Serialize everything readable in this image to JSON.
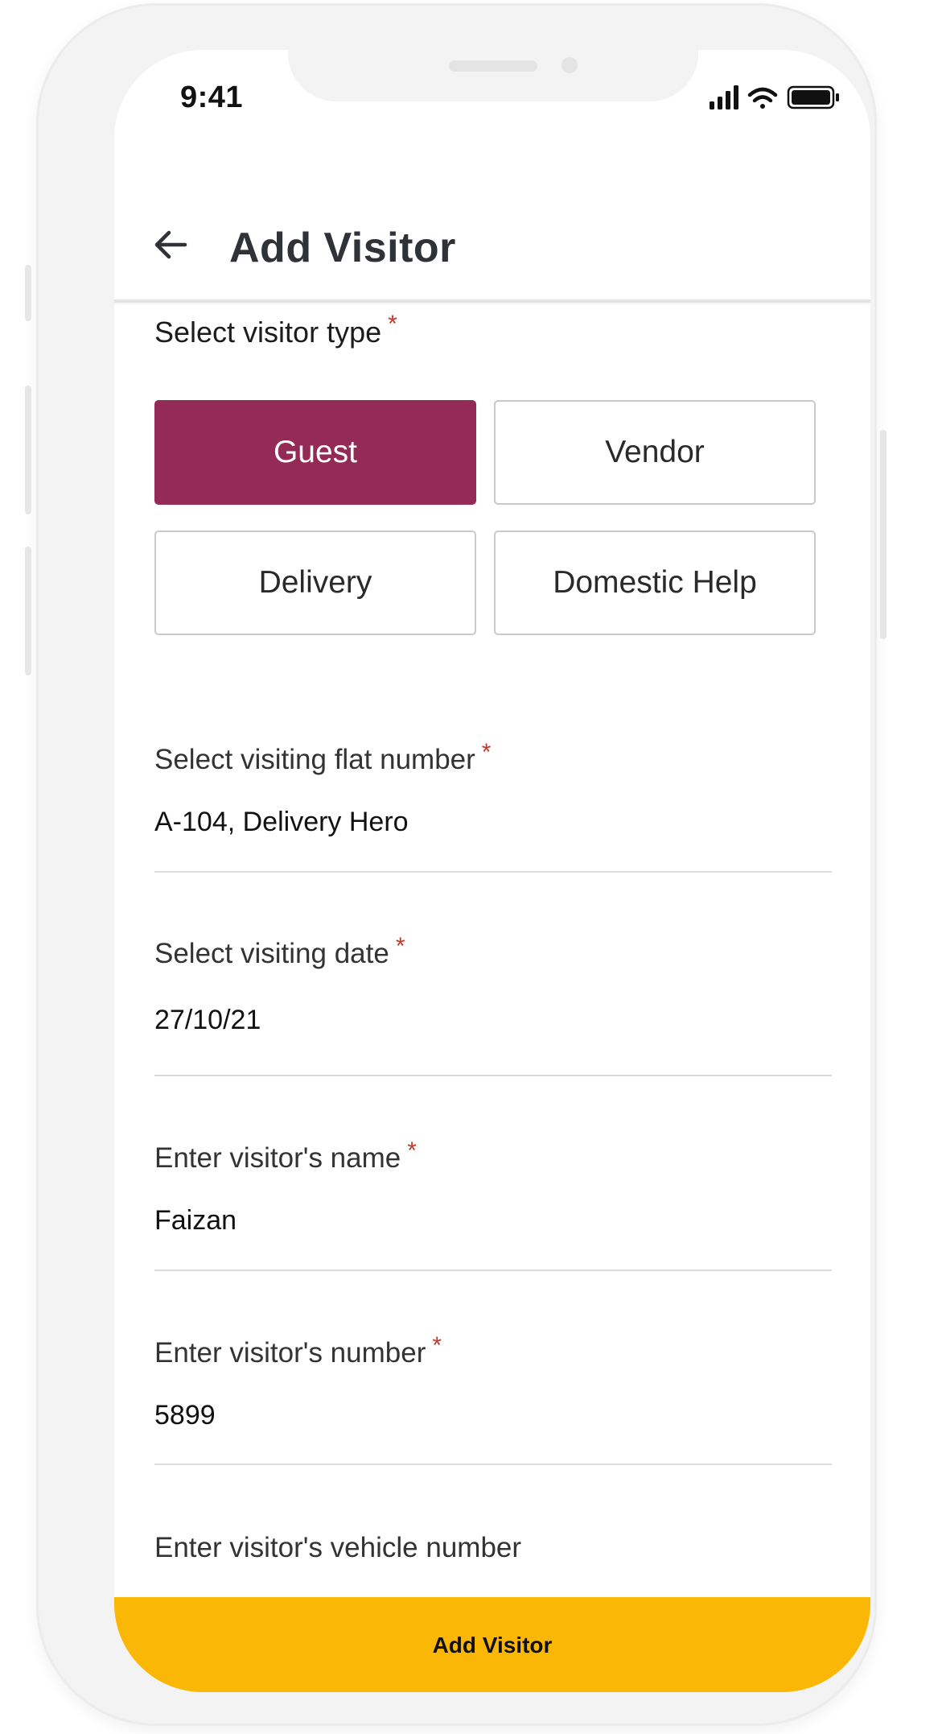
{
  "status_bar": {
    "time": "9:41"
  },
  "header": {
    "title": "Add Visitor"
  },
  "visitor_type": {
    "label": "Select visitor type",
    "required_mark": "*",
    "options": [
      "Guest",
      "Vendor",
      "Delivery",
      "Domestic Help"
    ],
    "selected": "Guest"
  },
  "fields": [
    {
      "label": "Select visiting flat number",
      "required_mark": "*",
      "value": "A-104, Delivery Hero"
    },
    {
      "label": "Select visiting date",
      "required_mark": "*",
      "value": "27/10/21"
    },
    {
      "label": "Enter visitor's name",
      "required_mark": "*",
      "value": "Faizan"
    },
    {
      "label": "Enter visitor's number",
      "required_mark": "*",
      "value": "5899"
    },
    {
      "label": "Enter visitor's vehicle number"
    }
  ],
  "submit": {
    "label": "Add Visitor"
  },
  "colors": {
    "accent": "#942b57",
    "primary_button": "#fbb705",
    "required": "#c0392b"
  },
  "icons": [
    "back-arrow-icon",
    "signal-icon",
    "wifi-icon",
    "battery-icon"
  ]
}
